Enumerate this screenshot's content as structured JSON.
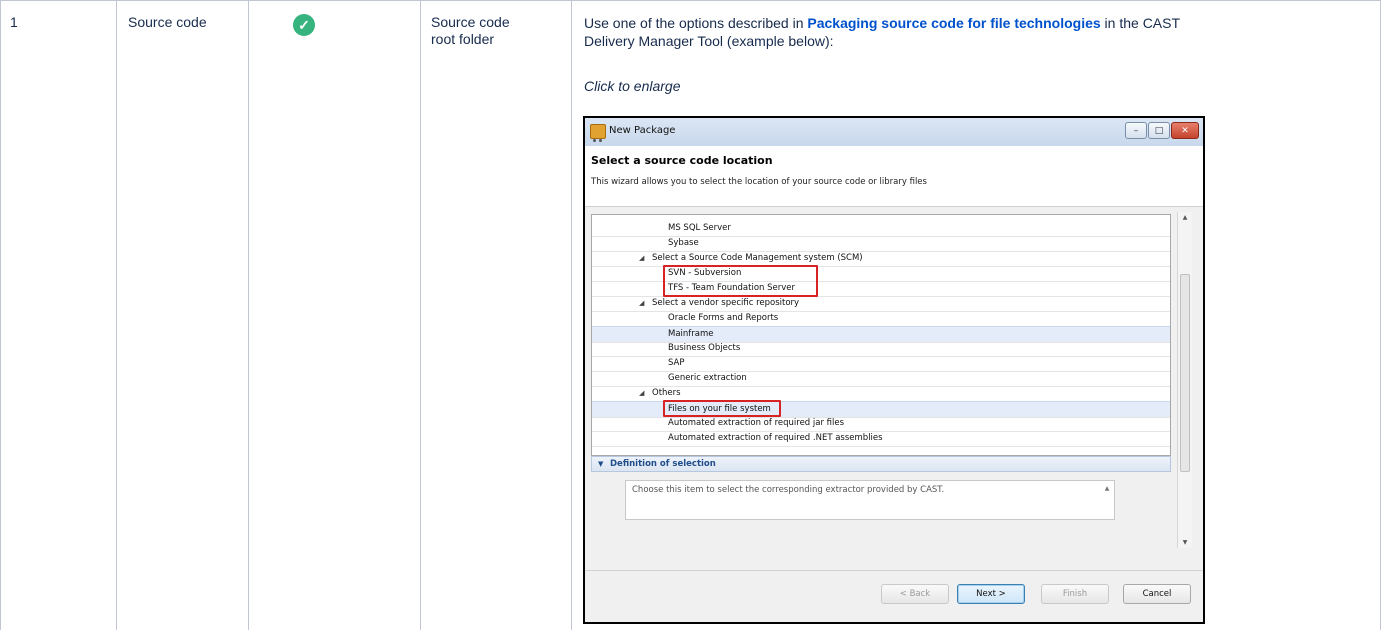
{
  "row": {
    "number": "1",
    "item": "Source code",
    "status_icon": "check-circle-icon",
    "location_line1": "Source code",
    "location_line2": "root folder"
  },
  "description": {
    "prefix": "Use one of the options described in ",
    "link": "Packaging source code for file technologies",
    "suffix_line1": " in the CAST",
    "line2": "Delivery Manager Tool (example below):",
    "caption": "Click to enlarge"
  },
  "dialog": {
    "title": "New Package",
    "heading": "Select a source code location",
    "subheading": "This wizard allows you to select the location of your source code or library files",
    "tree_rows": [
      {
        "label": "MS SQL Server"
      },
      {
        "label": "Sybase"
      },
      {
        "label": "Select a Source Code Management system (SCM)"
      },
      {
        "label": "SVN - Subversion"
      },
      {
        "label": "TFS - Team Foundation Server"
      },
      {
        "label": "Select a vendor specific repository"
      },
      {
        "label": "Oracle Forms and Reports"
      },
      {
        "label": "Mainframe"
      },
      {
        "label": "Business Objects"
      },
      {
        "label": "SAP"
      },
      {
        "label": "Generic extraction"
      },
      {
        "label": "Others"
      },
      {
        "label": "Files on your file system"
      },
      {
        "label": "Automated extraction of required jar files"
      },
      {
        "label": "Automated extraction of required .NET assemblies"
      }
    ],
    "definition_header": "Definition of selection",
    "definition_text": "Choose this item to select the corresponding extractor provided by CAST.",
    "buttons": {
      "back": "< Back",
      "next": "Next >",
      "finish": "Finish",
      "cancel": "Cancel"
    }
  }
}
